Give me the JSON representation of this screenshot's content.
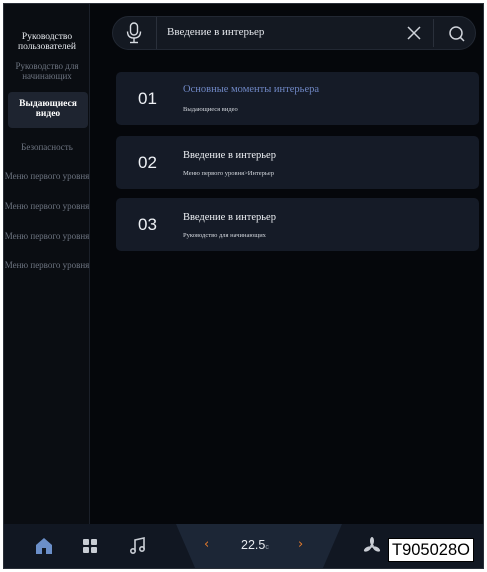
{
  "sidebar": {
    "title": "Руководство пользователей",
    "items": [
      {
        "label": "Руководство для начинающих"
      },
      {
        "label": "Выдающиеся видео"
      },
      {
        "label": "Безопасность"
      },
      {
        "label": "Меню первого уровня"
      },
      {
        "label": "Меню первого уровня"
      },
      {
        "label": "Меню первого уровня"
      },
      {
        "label": "Меню первого уровня"
      }
    ],
    "active_index": 1
  },
  "search": {
    "query": "Введение в интерьер",
    "icons": [
      "microphone-icon",
      "close-icon",
      "search-icon"
    ]
  },
  "results": [
    {
      "num": "01",
      "title": "Основные моменты интерьера",
      "subtitle": "Выдающиеся видео",
      "highlight": true
    },
    {
      "num": "02",
      "title": "Введение в интерьер",
      "subtitle": "Меню первого уровня>Интерьер",
      "highlight": false
    },
    {
      "num": "03",
      "title": "Введение в интерьер",
      "subtitle": "Руководство для начинающих",
      "highlight": false
    }
  ],
  "dock": {
    "icons": [
      "home-icon",
      "apps-grid-icon",
      "music-icon",
      "fan-icon"
    ],
    "temperature": "22.5",
    "temperature_unit": "c",
    "left_arrow": "‹",
    "right_arrow": "›"
  },
  "code_label": "T905028O",
  "colors": {
    "accent_link": "#6f87c4",
    "arrow": "#e37a2c",
    "card_bg": "#151b27",
    "screen_bg": "#05070b"
  }
}
